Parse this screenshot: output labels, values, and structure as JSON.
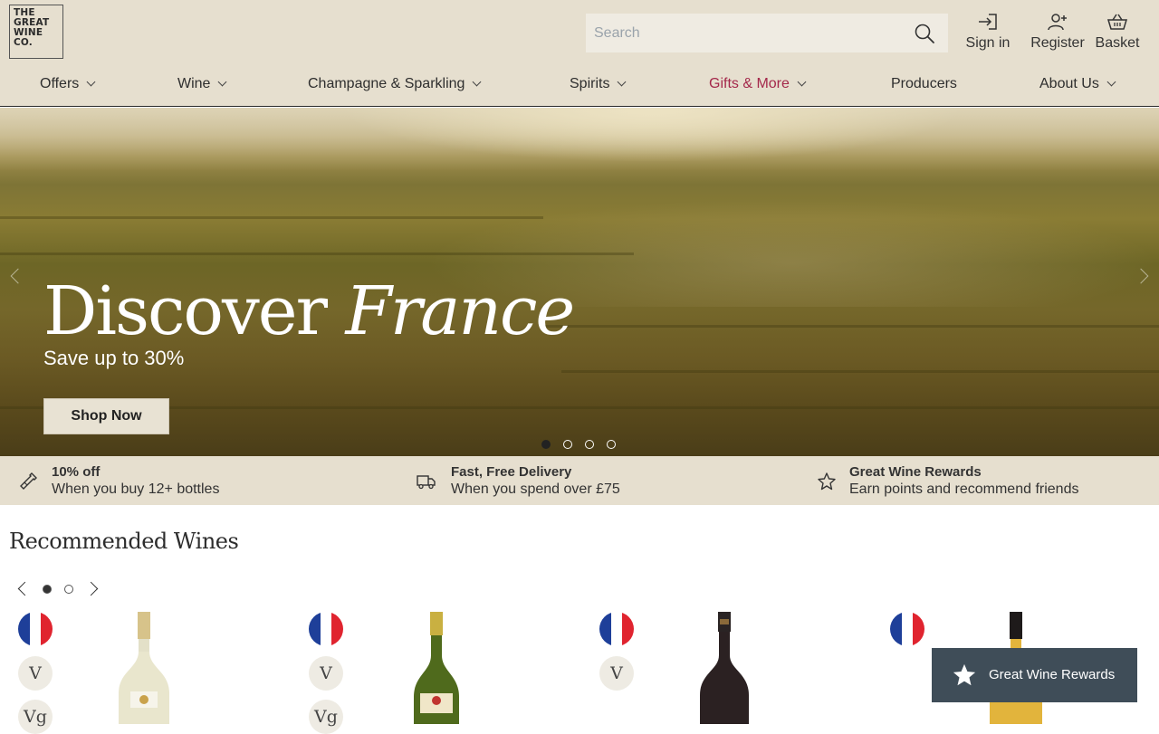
{
  "logo": {
    "lines": [
      "THE",
      "GREAT",
      "WINE",
      "CO."
    ]
  },
  "search": {
    "placeholder": "Search"
  },
  "header_actions": {
    "sign_in": "Sign in",
    "register": "Register",
    "basket": "Basket"
  },
  "nav": {
    "items": [
      {
        "label": "Offers",
        "has_dropdown": true
      },
      {
        "label": "Wine",
        "has_dropdown": true
      },
      {
        "label": "Champagne & Sparkling",
        "has_dropdown": true
      },
      {
        "label": "Spirits",
        "has_dropdown": true
      },
      {
        "label": "Gifts & More",
        "has_dropdown": true,
        "color": "#a4284b"
      },
      {
        "label": "Producers",
        "has_dropdown": false
      },
      {
        "label": "About Us",
        "has_dropdown": true
      }
    ]
  },
  "hero": {
    "title_plain": "Discover",
    "title_italic": "France",
    "subtitle": "Save up to 30%",
    "button": "Shop Now",
    "slides": 4,
    "active_slide": 1
  },
  "usps": [
    {
      "icon": "wine-bottle-icon",
      "title": "10% off",
      "text": "When you buy 12+ bottles"
    },
    {
      "icon": "delivery-truck-icon",
      "title": "Fast, Free Delivery",
      "text": "When you spend over £75"
    },
    {
      "icon": "star-icon",
      "title": "Great Wine Rewards",
      "text": "Earn points and recommend friends"
    }
  ],
  "recommended": {
    "title": "Recommended Wines",
    "pages": 2,
    "active_page": 1,
    "products": [
      {
        "country_flag": "france-flag-icon",
        "badges": [
          "V",
          "Vg"
        ],
        "bottle": "white-wine-bottle"
      },
      {
        "country_flag": "france-flag-icon",
        "badges": [
          "V",
          "Vg"
        ],
        "bottle": "green-riesling-bottle"
      },
      {
        "country_flag": "france-flag-icon",
        "badges": [
          "V"
        ],
        "bottle": "red-wine-bottle"
      },
      {
        "country_flag": "france-flag-icon",
        "badges": [],
        "bottle": "white-burgundy-bottle"
      }
    ]
  },
  "rewards_widget": {
    "label": "Great Wine Rewards"
  },
  "colors": {
    "header_bg": "#e6dfcf",
    "accent_nav": "#a4284b",
    "rewards_bg": "#3f4d58",
    "button_bg": "#e8e2d3"
  }
}
